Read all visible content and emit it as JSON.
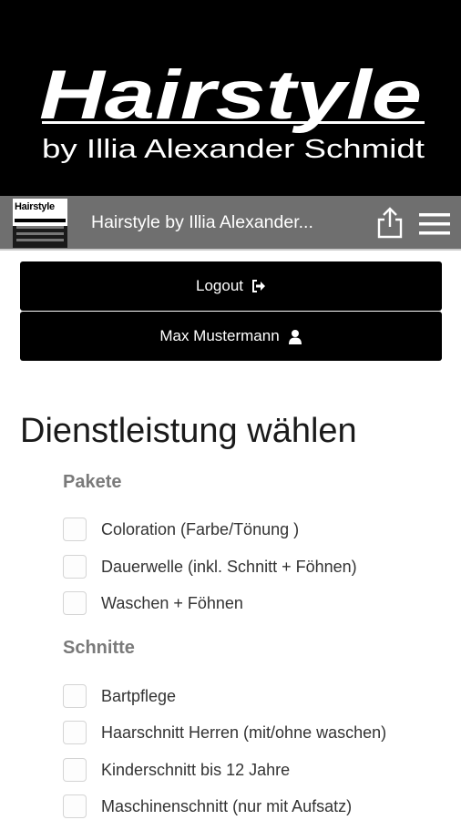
{
  "banner": {
    "brand": "Hairstyle",
    "tagline": "by Illia Alexander Schmidt"
  },
  "appbar": {
    "logo_text": "Hairstyle",
    "title": "Hairstyle by Illia Alexander...",
    "share_icon": "share-icon",
    "menu_icon": "hamburger-menu-icon"
  },
  "buttons": {
    "logout_label": "Logout",
    "logout_icon": "sign-out-icon",
    "user_label": "Max Mustermann",
    "user_icon": "user-icon"
  },
  "main": {
    "title": "Dienstleistung wählen",
    "sections": [
      {
        "title": "Pakete",
        "options": [
          "Coloration (Farbe/Tönung )",
          "Dauerwelle (inkl. Schnitt + Föhnen)",
          "Waschen + Föhnen"
        ]
      },
      {
        "title": "Schnitte",
        "options": [
          "Bartpflege",
          "Haarschnitt Herren (mit/ohne waschen)",
          "Kinderschnitt bis 12 Jahre",
          "Maschinenschnitt (nur mit Aufsatz)"
        ]
      }
    ]
  }
}
